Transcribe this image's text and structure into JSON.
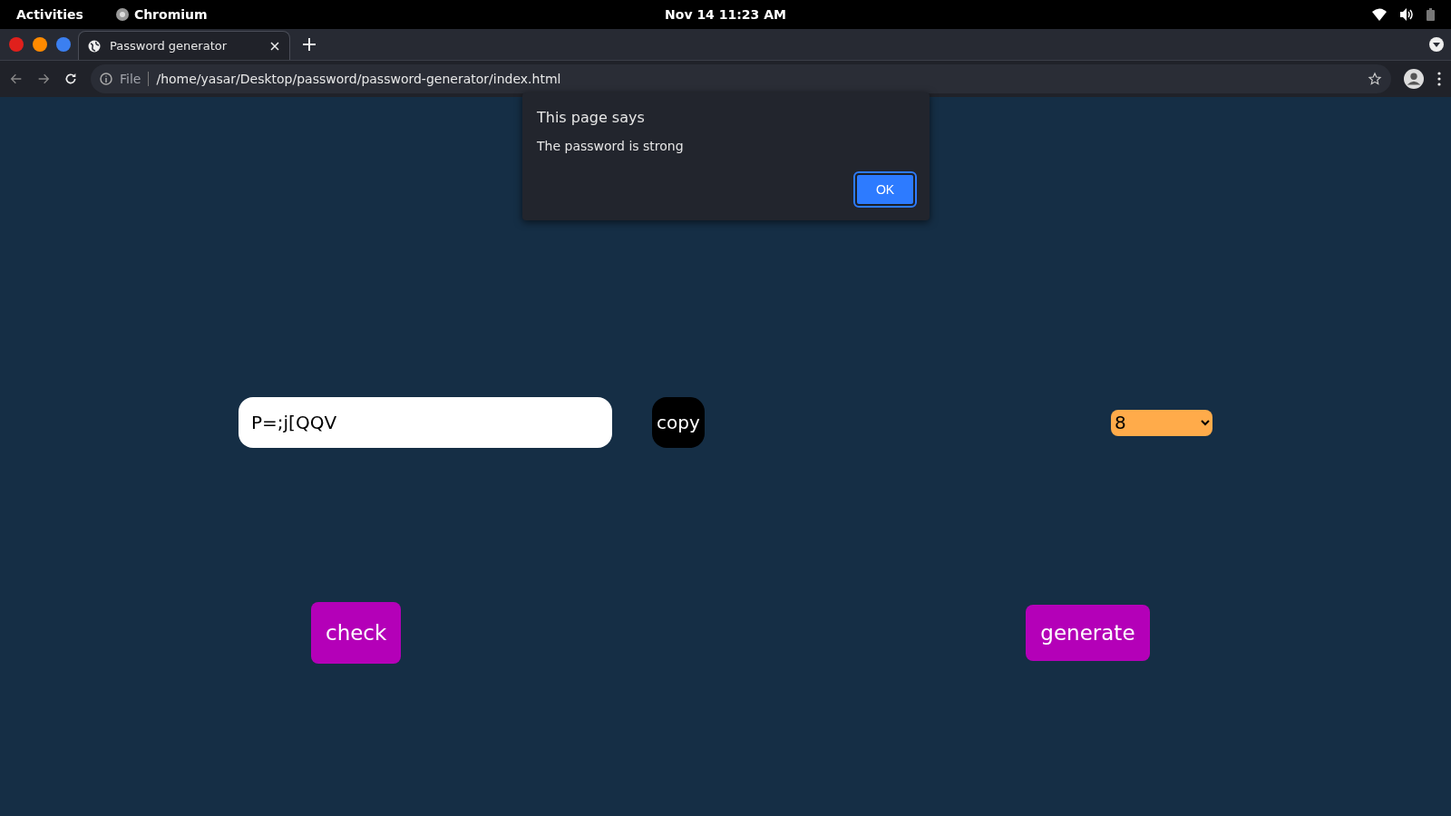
{
  "top_bar": {
    "activities": "Activities",
    "app_name": "Chromium",
    "clock": "Nov 14  11:23 AM"
  },
  "browser": {
    "tabs": [
      {
        "title": "Password generator",
        "selected": true
      }
    ],
    "address_bar": {
      "scheme": "File",
      "url": "/home/yasar/Desktop/password/password-generator/index.html"
    }
  },
  "page": {
    "password_field": {
      "value": "P=;j[QQV"
    },
    "copy_button": "copy",
    "length_select": {
      "value": "8"
    },
    "check_button": "check",
    "generate_button": "generate"
  },
  "dialog": {
    "title": "This page says",
    "message": "The password is strong",
    "button": "OK"
  }
}
